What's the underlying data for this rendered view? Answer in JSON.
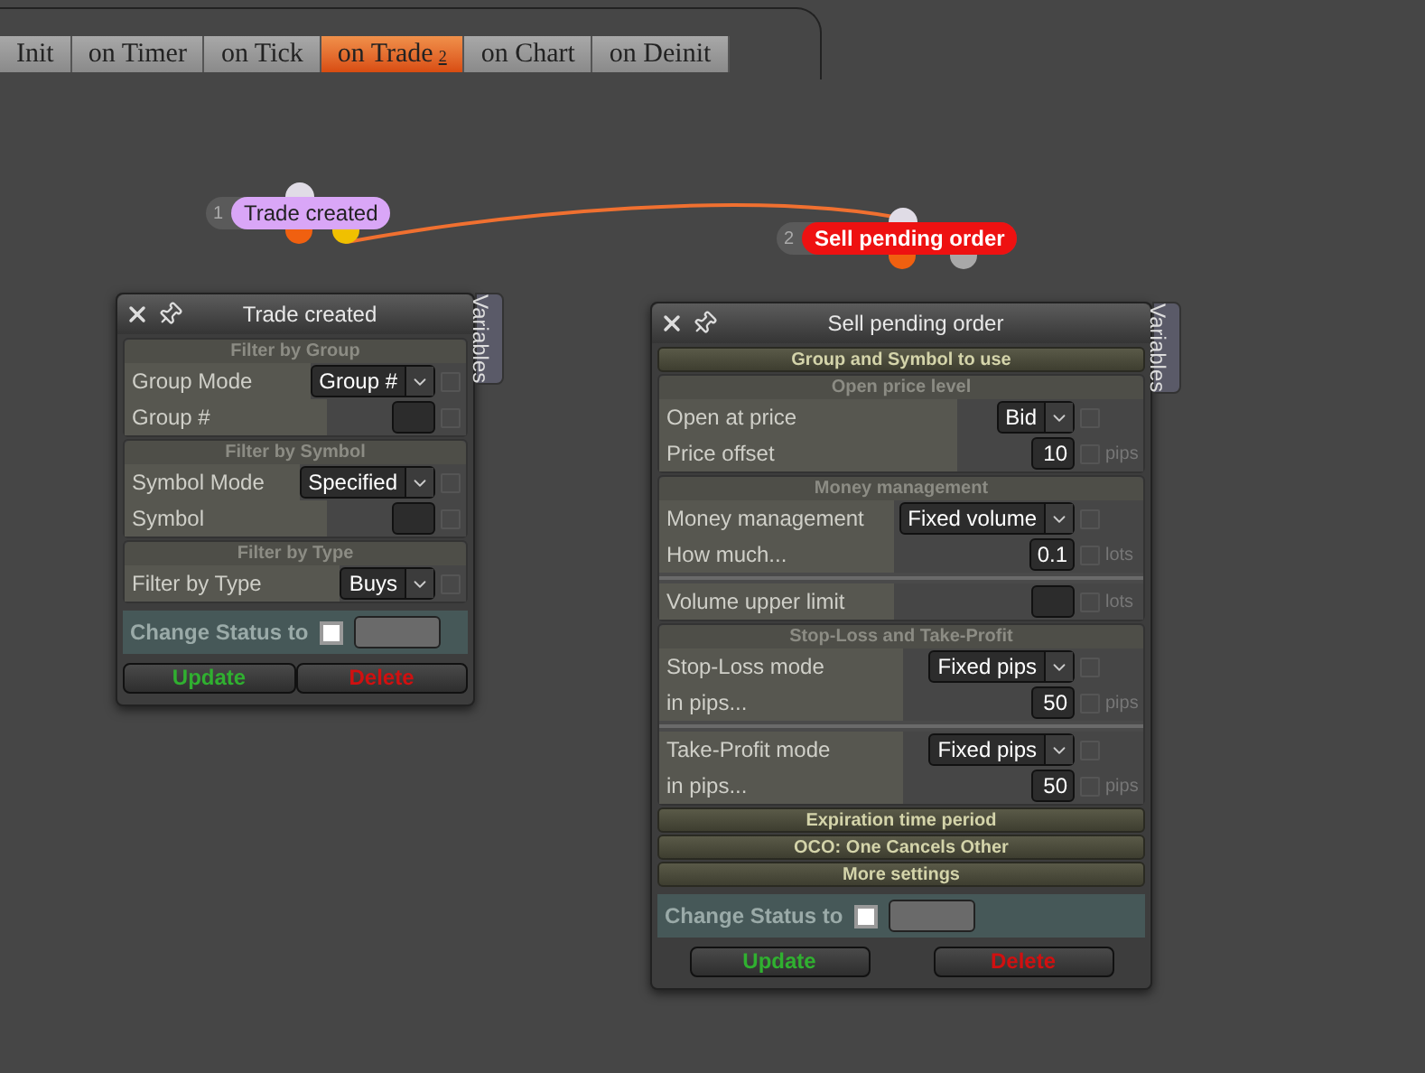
{
  "tabs": [
    {
      "label": "Init",
      "selected": false
    },
    {
      "label": "on Timer",
      "selected": false
    },
    {
      "label": "on Tick",
      "selected": false
    },
    {
      "label": "on Trade",
      "selected": true,
      "badge": "2"
    },
    {
      "label": "on Chart",
      "selected": false
    },
    {
      "label": "on Deinit",
      "selected": false
    }
  ],
  "nodes": [
    {
      "number": "1",
      "label": "Trade created",
      "color": "#d9a6f7"
    },
    {
      "number": "2",
      "label": "Sell pending order",
      "color": "#ee1111"
    }
  ],
  "panels": [
    {
      "title": "Trade created",
      "side_tab": "Variables",
      "sections": [
        {
          "title": "Filter by Group",
          "expanded": true,
          "blocks": [
            [
              {
                "kind": "select",
                "label": "Group Mode",
                "value": "Group #",
                "checked": false
              },
              {
                "kind": "input",
                "label": "Group #",
                "checked": false
              }
            ]
          ]
        },
        {
          "title": "Filter by Symbol",
          "expanded": true,
          "blocks": [
            [
              {
                "kind": "select",
                "label": "Symbol Mode",
                "value": "Specified",
                "checked": false
              },
              {
                "kind": "input",
                "label": "Symbol",
                "checked": false
              }
            ]
          ]
        },
        {
          "title": "Filter by Type",
          "expanded": true,
          "blocks": [
            [
              {
                "kind": "select",
                "label": "Filter by Type",
                "value": "Buys",
                "checked": false
              }
            ]
          ]
        }
      ],
      "status": {
        "label": "Change Status to",
        "checked": false
      },
      "buttons": [
        {
          "label": "Update",
          "kind": "confirm"
        },
        {
          "label": "Delete",
          "kind": "danger"
        }
      ]
    },
    {
      "title": "Sell pending order",
      "side_tab": "Variables",
      "sections": [
        {
          "title": "Group and Symbol to use",
          "expanded": false
        },
        {
          "title": "Open price level",
          "expanded": true,
          "blocks": [
            [
              {
                "kind": "select",
                "label": "Open at price",
                "value": "Bid",
                "checked": false
              },
              {
                "kind": "input",
                "label": "Price offset",
                "value": "10",
                "unit": "pips",
                "checked": false
              }
            ]
          ]
        },
        {
          "title": "Money management",
          "expanded": true,
          "blocks": [
            [
              {
                "kind": "select",
                "label": "Money management",
                "value": "Fixed volume",
                "checked": false
              },
              {
                "kind": "input",
                "label": "How much...",
                "value": "0.1",
                "unit": "lots",
                "checked": false
              }
            ],
            [
              {
                "kind": "input",
                "label": "Volume upper limit",
                "unit": "lots",
                "checked": false
              }
            ]
          ]
        },
        {
          "title": "Stop-Loss and Take-Profit",
          "expanded": true,
          "blocks": [
            [
              {
                "kind": "select",
                "label": "Stop-Loss mode",
                "value": "Fixed pips",
                "checked": false
              },
              {
                "kind": "input",
                "label": "in pips...",
                "value": "50",
                "unit": "pips",
                "checked": false
              }
            ],
            [
              {
                "kind": "select",
                "label": "Take-Profit mode",
                "value": "Fixed pips",
                "checked": false
              },
              {
                "kind": "input",
                "label": "in pips...",
                "value": "50",
                "unit": "pips",
                "checked": false
              }
            ]
          ]
        },
        {
          "title": "Expiration time period",
          "expanded": false
        },
        {
          "title": "OCO: One Cancels Other",
          "expanded": false
        },
        {
          "title": "More settings",
          "expanded": false
        }
      ],
      "status": {
        "label": "Change Status to",
        "checked": false
      },
      "buttons": [
        {
          "label": "Update",
          "kind": "confirm"
        },
        {
          "label": "Delete",
          "kind": "danger"
        }
      ]
    }
  ]
}
